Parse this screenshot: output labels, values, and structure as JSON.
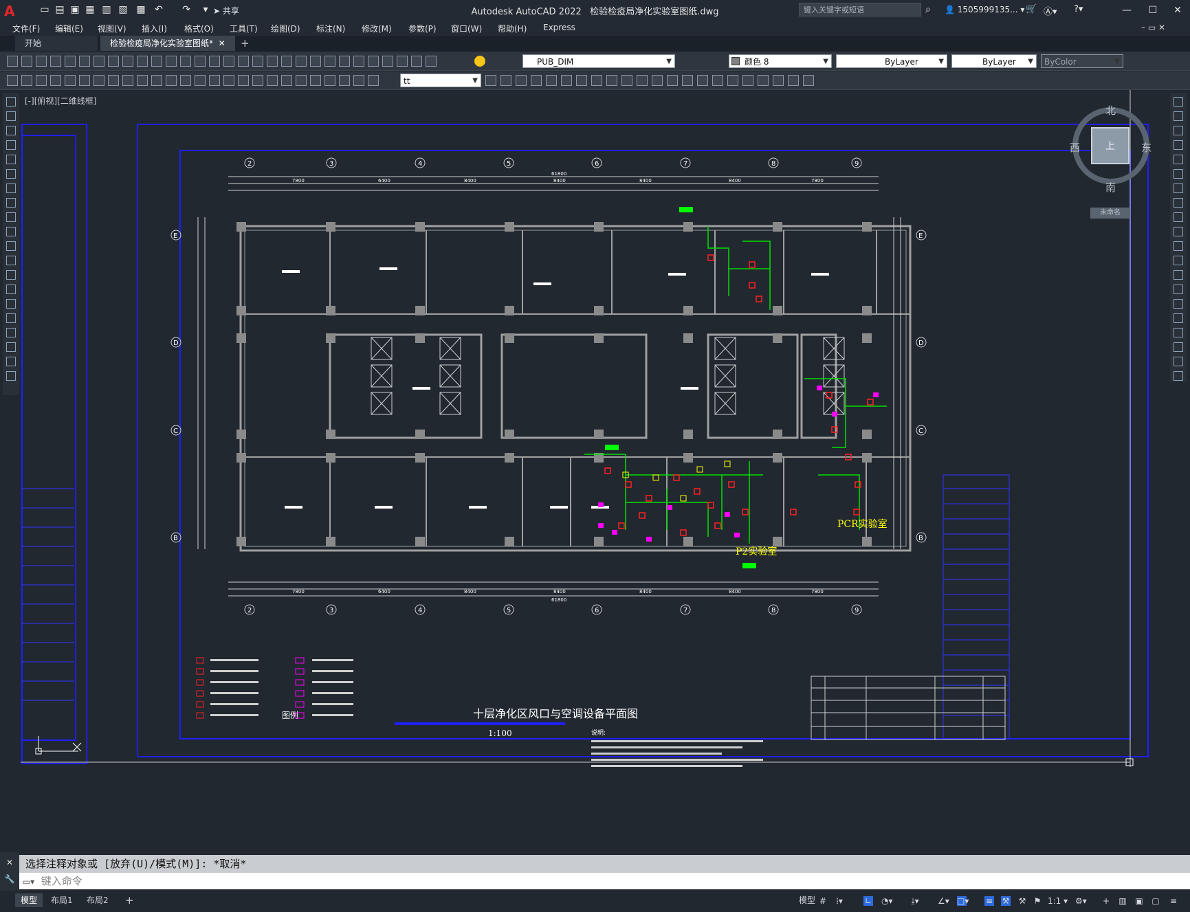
{
  "app": {
    "logo": "A",
    "title": "Autodesk AutoCAD 2022",
    "filename": "检验检疫局净化实验室图纸.dwg",
    "share_label": "共享",
    "search_placeholder": "键入关键字或短语",
    "user": "1505999135...",
    "colors": {
      "background": "#212830",
      "accent": "#0060ff",
      "frame": "#0000ff"
    }
  },
  "menu": [
    "文件(F)",
    "编辑(E)",
    "视图(V)",
    "插入(I)",
    "格式(O)",
    "工具(T)",
    "绘图(D)",
    "标注(N)",
    "修改(M)",
    "参数(P)",
    "窗口(W)",
    "帮助(H)",
    "Express"
  ],
  "tabs": {
    "start": "开始",
    "drawing": "检验检疫局净化实验室图纸*",
    "add": "+"
  },
  "toolbar": {
    "layer": "PUB_DIM",
    "color": "颜色 8",
    "linetype": "ByLayer",
    "lineweight": "ByLayer",
    "plotstyle": "ByColor",
    "textstyle": "tt"
  },
  "viewport": {
    "label": "[-][俯视][二维线框]"
  },
  "viewcube": {
    "north": "北",
    "south": "南",
    "east": "东",
    "west": "西",
    "top": "上",
    "wcs": "未命名"
  },
  "drawing": {
    "title": "十层净化区风口与空调设备平面图",
    "scale": "1:100",
    "legend_title": "图例",
    "notes_title": "说明:",
    "room_labels": [
      "PCR实验室",
      "P2实验室"
    ],
    "grid_top": [
      "2",
      "3",
      "4",
      "5",
      "6",
      "7",
      "8",
      "9"
    ],
    "grid_side": [
      "E",
      "D",
      "C",
      "B"
    ],
    "dimensions_top": [
      "7800",
      "6400",
      "8400",
      "8400",
      "8400",
      "8400",
      "7800"
    ],
    "total_dim": "61800"
  },
  "command": {
    "history": "选择注释对象或 [放弃(U)/模式(M)]: *取消*",
    "placeholder": "键入命令"
  },
  "status": {
    "layouts": [
      "模型",
      "布局1",
      "布局2"
    ],
    "model_label": "模型",
    "scale": "1:1"
  }
}
